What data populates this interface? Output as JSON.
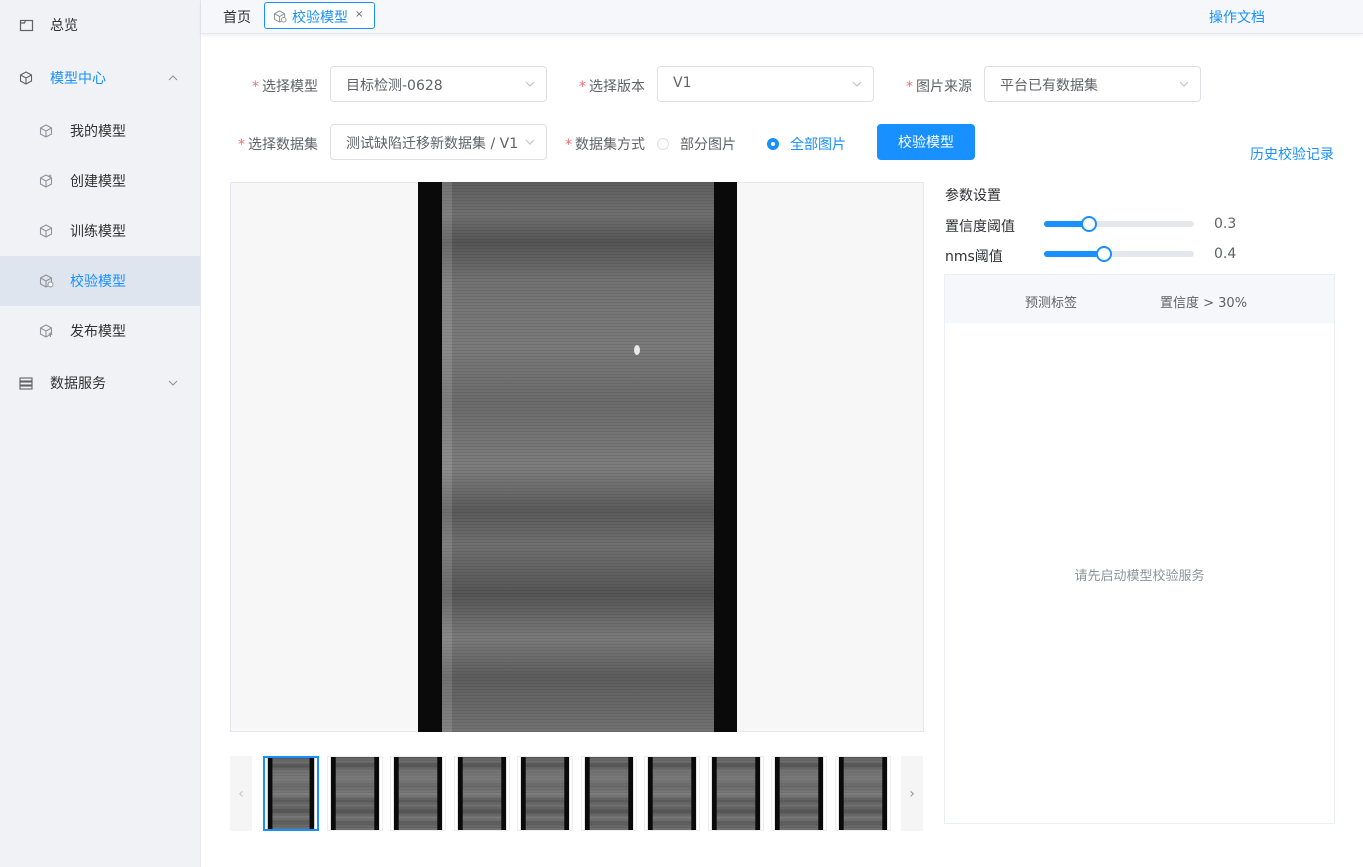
{
  "sidebar": {
    "items": [
      {
        "label": "总览",
        "icon": "overview-icon"
      },
      {
        "label": "模型中心",
        "icon": "cube-icon"
      },
      {
        "label": "我的模型",
        "icon": "cube-icon"
      },
      {
        "label": "创建模型",
        "icon": "cube-add-icon"
      },
      {
        "label": "训练模型",
        "icon": "cube-icon"
      },
      {
        "label": "校验模型",
        "icon": "cube-check-icon"
      },
      {
        "label": "发布模型",
        "icon": "cube-publish-icon"
      },
      {
        "label": "数据服务",
        "icon": "database-icon"
      }
    ],
    "active_item": "校验模型"
  },
  "topbar": {
    "home_tab": "首页",
    "active_tab": "校验模型",
    "close_symbol": "×",
    "docs_link": "操作文档"
  },
  "form": {
    "model_label": "选择模型",
    "model_value": "目标检测-0628",
    "version_label": "选择版本",
    "version_value": "V1",
    "source_label": "图片来源",
    "source_value": "平台已有数据集",
    "dataset_label": "选择数据集",
    "dataset_value": "测试缺陷迁移新数据集 / V1",
    "mode_label": "数据集方式",
    "mode_options": [
      "部分图片",
      "全部图片"
    ],
    "mode_selected": "全部图片",
    "required_mark": "*",
    "verify_button": "校验模型",
    "history_link": "历史校验记录"
  },
  "params": {
    "title": "参数设置",
    "confidence_label": "置信度阈值",
    "confidence_value": "0.3",
    "confidence_fraction": 0.3,
    "nms_label": "nms阈值",
    "nms_value": "0.4",
    "nms_fraction": 0.4
  },
  "result": {
    "col_label": "预测标签",
    "col_confidence": "置信度 > 30%",
    "empty_text": "请先启动模型校验服务"
  },
  "thumbnails": {
    "count": 10,
    "selected_index": 0,
    "prev_symbol": "‹",
    "next_symbol": "›"
  },
  "colors": {
    "accent": "#1890ff",
    "required": "#f56c6c",
    "sidebar_bg": "#f0f2f5"
  }
}
